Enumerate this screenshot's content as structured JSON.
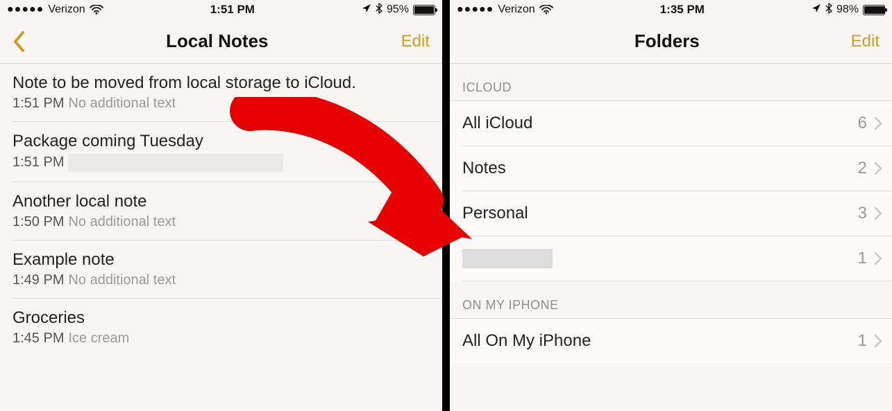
{
  "left": {
    "status": {
      "carrier": "Verizon",
      "time": "1:51 PM",
      "battery_pct": "95%",
      "battery_fill": 94
    },
    "nav": {
      "title": "Local Notes",
      "edit": "Edit"
    },
    "notes": [
      {
        "title": "Note to be moved from local storage to iCloud.",
        "time": "1:51 PM",
        "preview": "No additional text"
      },
      {
        "title": "Package coming Tuesday",
        "time": "1:51 PM",
        "preview": ""
      },
      {
        "title": "Another local note",
        "time": "1:50 PM",
        "preview": "No additional text"
      },
      {
        "title": "Example note",
        "time": "1:49 PM",
        "preview": "No additional text"
      },
      {
        "title": "Groceries",
        "time": "1:45 PM",
        "preview": "Ice cream"
      }
    ]
  },
  "right": {
    "status": {
      "carrier": "Verizon",
      "time": "1:35 PM",
      "battery_pct": "98%",
      "battery_fill": 97
    },
    "nav": {
      "title": "Folders",
      "edit": "Edit"
    },
    "sections": {
      "icloud_header": "ICLOUD",
      "onmyiphone_header": "ON MY IPHONE"
    },
    "icloud_folders": [
      {
        "name": "All iCloud",
        "count": "6"
      },
      {
        "name": "Notes",
        "count": "2"
      },
      {
        "name": "Personal",
        "count": "3"
      },
      {
        "name": "",
        "count": "1"
      }
    ],
    "iphone_folders": [
      {
        "name": "All On My iPhone",
        "count": "1"
      }
    ]
  }
}
